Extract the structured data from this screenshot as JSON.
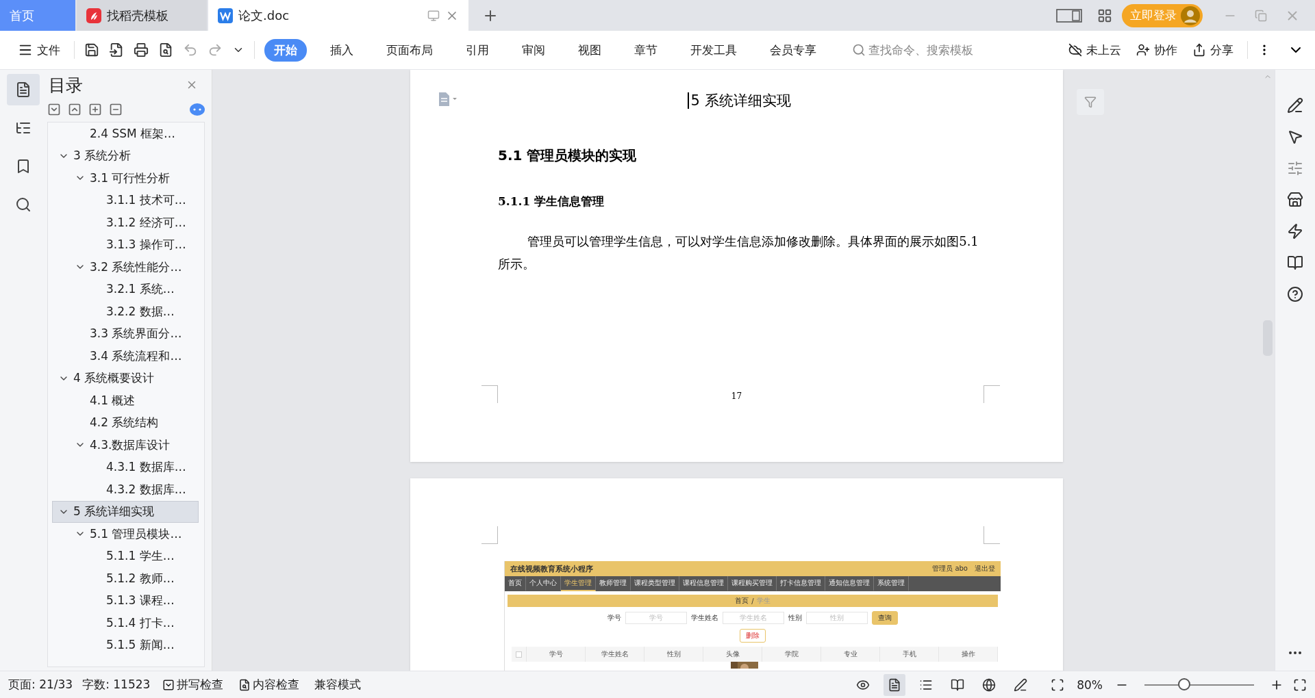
{
  "tabs": [
    {
      "label": "首页",
      "kind": "home",
      "selected": false
    },
    {
      "label": "找稻壳模板",
      "kind": "template",
      "selected": false
    },
    {
      "label": "论文.doc",
      "kind": "doc",
      "selected": true
    }
  ],
  "login_button": "立即登录",
  "toolbar": {
    "file_menu": "文件",
    "ribbon_tabs": [
      {
        "label": "开始",
        "selected": true
      },
      {
        "label": "插入",
        "selected": false
      },
      {
        "label": "页面布局",
        "selected": false
      },
      {
        "label": "引用",
        "selected": false
      },
      {
        "label": "审阅",
        "selected": false
      },
      {
        "label": "视图",
        "selected": false
      },
      {
        "label": "章节",
        "selected": false
      },
      {
        "label": "开发工具",
        "selected": false
      },
      {
        "label": "会员专享",
        "selected": false
      }
    ],
    "search_placeholder": "查找命令、搜索模板",
    "actions": [
      {
        "kind": "cloud",
        "label": "未上云"
      },
      {
        "kind": "collab",
        "label": "协作"
      },
      {
        "kind": "share",
        "label": "分享"
      }
    ]
  },
  "side_tools": [
    {
      "kind": "toc",
      "selected": true
    },
    {
      "kind": "nav",
      "selected": false
    },
    {
      "kind": "bookmark",
      "selected": false
    },
    {
      "kind": "search",
      "selected": false
    }
  ],
  "toc": {
    "title": "目录",
    "orphan_items": [
      {
        "label": "2.4 SSM 框架…",
        "selected": false
      }
    ],
    "items": [
      {
        "label": "3 系统分析",
        "selected": false,
        "expanded": true,
        "children": [
          {
            "label": "3.1 可行性分析",
            "selected": false,
            "expanded": true,
            "children": [
              {
                "label": "3.1.1 技术可…",
                "selected": false
              },
              {
                "label": "3.1.2 经济可…",
                "selected": false
              },
              {
                "label": "3.1.3 操作可…",
                "selected": false
              }
            ]
          },
          {
            "label": "3.2 系统性能分…",
            "selected": false,
            "expanded": true,
            "children": [
              {
                "label": "3.2.1  系统…",
                "selected": false
              },
              {
                "label": "3.2.2  数据…",
                "selected": false
              }
            ]
          },
          {
            "label": "3.3 系统界面分…",
            "selected": false
          },
          {
            "label": "3.4 系统流程和…",
            "selected": false
          }
        ]
      },
      {
        "label": "4 系统概要设计",
        "selected": false,
        "expanded": true,
        "children": [
          {
            "label": "4.1 概述",
            "selected": false
          },
          {
            "label": "4.2 系统结构",
            "selected": false
          },
          {
            "label": "4.3.数据库设计",
            "selected": false,
            "expanded": true,
            "children": [
              {
                "label": "4.3.1 数据库…",
                "selected": false
              },
              {
                "label": "4.3.2 数据库…",
                "selected": false
              }
            ]
          }
        ]
      },
      {
        "label": "5 系统详细实现",
        "selected": true,
        "expanded": true,
        "children": [
          {
            "label": "5.1  管理员模块…",
            "selected": false,
            "expanded": true,
            "children": [
              {
                "label": "5.1.1  学生…",
                "selected": false
              },
              {
                "label": "5.1.2  教师…",
                "selected": false
              },
              {
                "label": "5.1.3  课程…",
                "selected": false
              },
              {
                "label": "5.1.4  打卡…",
                "selected": false
              },
              {
                "label": "5.1.5  新闻…",
                "selected": false
              }
            ]
          }
        ]
      }
    ]
  },
  "document": {
    "chapter_heading": "5 系统详细实现",
    "section_heading": "5.1  管理员模块的实现",
    "subsection_heading": "5.1.1  学生信息管理",
    "paragraph": "管理员可以管理学生信息，可以对学生信息添加修改删除。具体界面的展示如图5.1所示。",
    "page_number": "17",
    "figure": {
      "app_title": "在线视频教育系统小程序",
      "user": "管理员 abo",
      "logout": "退出登",
      "nav": [
        {
          "label": "首页",
          "selected": false
        },
        {
          "label": "个人中心",
          "selected": false
        },
        {
          "label": "学生管理",
          "selected": true
        },
        {
          "label": "教师管理",
          "selected": false
        },
        {
          "label": "课程类型管理",
          "selected": false
        },
        {
          "label": "课程信息管理",
          "selected": false
        },
        {
          "label": "课程购买管理",
          "selected": false
        },
        {
          "label": "打卡信息管理",
          "selected": false
        },
        {
          "label": "通知信息管理",
          "selected": false
        },
        {
          "label": "系统管理",
          "selected": false
        }
      ],
      "breadcrumb": {
        "home": "首页",
        "separator": "/",
        "current": "学生"
      },
      "filters": [
        {
          "label": "学号",
          "placeholder": "学号"
        },
        {
          "label": "学生姓名",
          "placeholder": "学生姓名"
        },
        {
          "label": "性别",
          "placeholder": "性别"
        }
      ],
      "search_button": "查询",
      "delete_button": "删除",
      "columns": [
        "学号",
        "学生姓名",
        "性别",
        "头像",
        "学院",
        "专业",
        "手机",
        "操作"
      ]
    }
  },
  "status_bar": {
    "page": "页面: 21/33",
    "words": "字数: 11523",
    "spell_check": "拼写检查",
    "content_check": "内容检查",
    "compat_mode": "兼容模式",
    "view_modes": [
      {
        "kind": "eye",
        "selected": false
      },
      {
        "kind": "page",
        "selected": true
      },
      {
        "kind": "outline",
        "selected": false
      },
      {
        "kind": "read",
        "selected": false
      },
      {
        "kind": "web",
        "selected": false
      },
      {
        "kind": "write",
        "selected": false
      }
    ],
    "zoom": "80%",
    "zoom_slider": {
      "level": 0.36
    }
  }
}
